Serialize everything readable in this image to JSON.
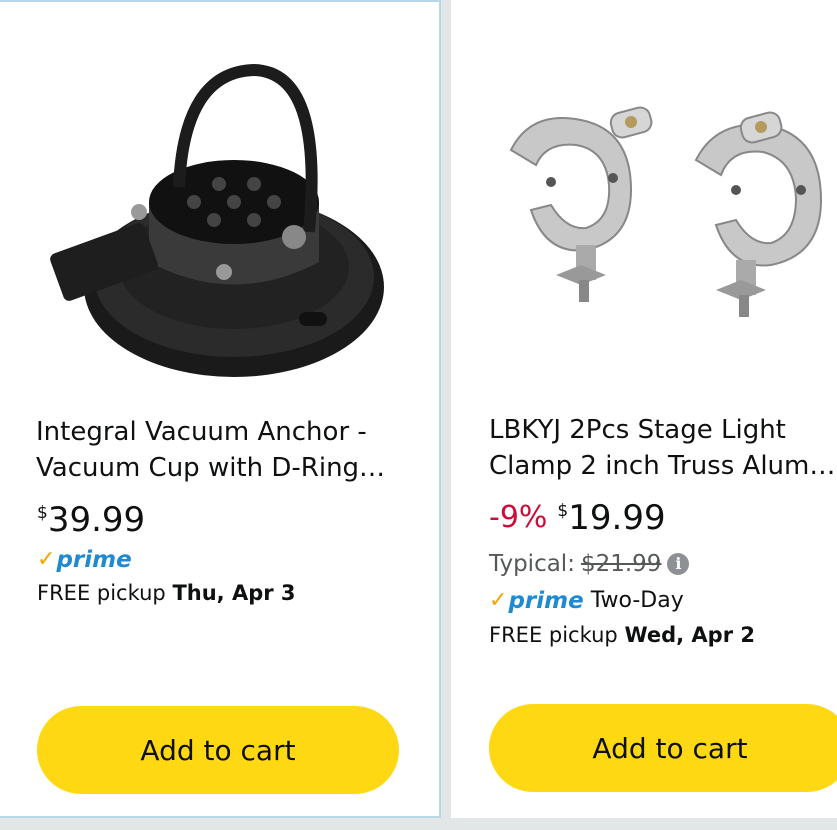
{
  "products": [
    {
      "title_line1": "Integral Vacuum Anchor -",
      "title_line2": "Vacuum Cup with D-Ring…",
      "currency": "$",
      "price": "39.99",
      "prime_check": "✓",
      "prime_label": "prime",
      "pickup_prefix": "FREE pickup",
      "pickup_date": "Thu, Apr 3",
      "add_to_cart": "Add to cart",
      "image_icon": "vacuum-anchor-image"
    },
    {
      "title_line1": "LBKYJ 2Pcs Stage Light",
      "title_line2": "Clamp 2 inch Truss Alumi…",
      "discount": "-9%",
      "currency": "$",
      "price": "19.99",
      "typical_label": "Typical:",
      "typical_price": "$21.99",
      "info_icon": "i",
      "prime_check": "✓",
      "prime_label": "prime",
      "delivery_speed": "Two-Day",
      "pickup_prefix": "FREE pickup",
      "pickup_date": "Wed, Apr 2",
      "add_to_cart": "Add to cart",
      "image_icon": "truss-clamp-image"
    }
  ],
  "colors": {
    "button": "#ffd814",
    "discount": "#cc0c39",
    "prime": "#1f8ad1",
    "prime_check": "#f7a300",
    "selected_border": "#b7d6e6"
  }
}
